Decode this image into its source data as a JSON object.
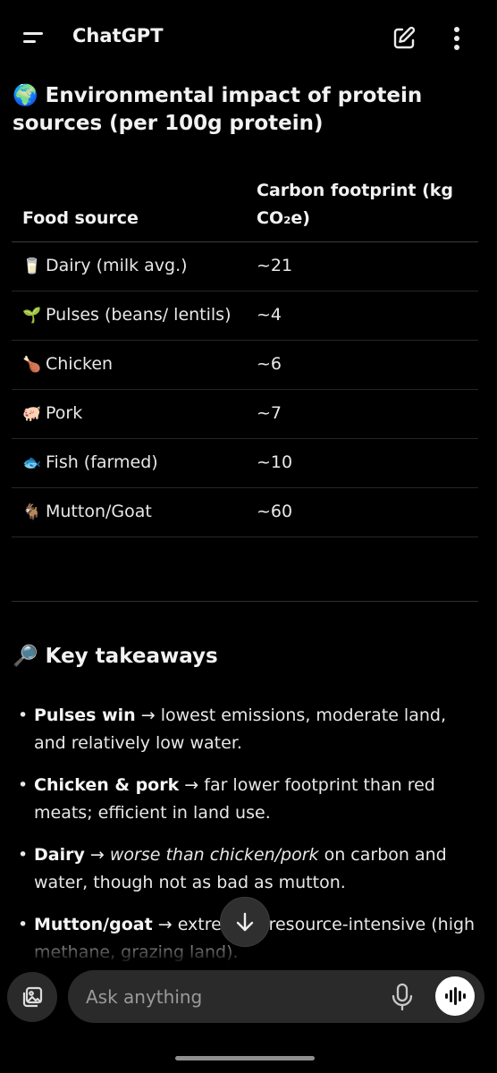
{
  "app": {
    "title": "ChatGPT"
  },
  "heading": {
    "emoji": "🌍",
    "text": "Environmental impact of protein sources (per 100g protein)"
  },
  "table": {
    "headers": [
      "Food source",
      "Carbon footprint (kg CO₂e)"
    ],
    "rows": [
      {
        "emoji": "🥛",
        "food": "Dairy (milk avg.)",
        "value": "~21"
      },
      {
        "emoji": "🌱",
        "food": "Pulses (beans/ lentils)",
        "value": "~4"
      },
      {
        "emoji": "🍗",
        "food": "Chicken",
        "value": "~6"
      },
      {
        "emoji": "🐖",
        "food": "Pork",
        "value": "~7"
      },
      {
        "emoji": "🐟",
        "food": "Fish (farmed)",
        "value": "~10"
      },
      {
        "emoji": "🐐",
        "food": "Mutton/Goat",
        "value": "~60"
      }
    ]
  },
  "takeaways": {
    "emoji": "🔎",
    "heading": "Key takeaways",
    "items": [
      {
        "bold": "Pulses win",
        "arrow": " → ",
        "text": "lowest emissions, moderate land, and relatively low water."
      },
      {
        "bold": "Chicken & pork",
        "arrow": " → ",
        "text": "far lower footprint than red meats; efficient in land use."
      },
      {
        "bold": "Dairy",
        "arrow": " → ",
        "italic": "worse than chicken/pork",
        "text": " on carbon and water, though not as bad as mutton."
      },
      {
        "bold": "Mutton/goat",
        "arrow": " → ",
        "text": "extremely resource-intensive (high methane, grazing land)."
      }
    ]
  },
  "composer": {
    "placeholder": "Ask anything"
  },
  "icons": {
    "menu": "menu-icon",
    "new_chat": "edit-icon",
    "more": "more-vertical-icon",
    "scroll_down": "arrow-down-icon",
    "attach": "gallery-icon",
    "mic": "microphone-icon",
    "voice": "voice-waveform-icon"
  }
}
